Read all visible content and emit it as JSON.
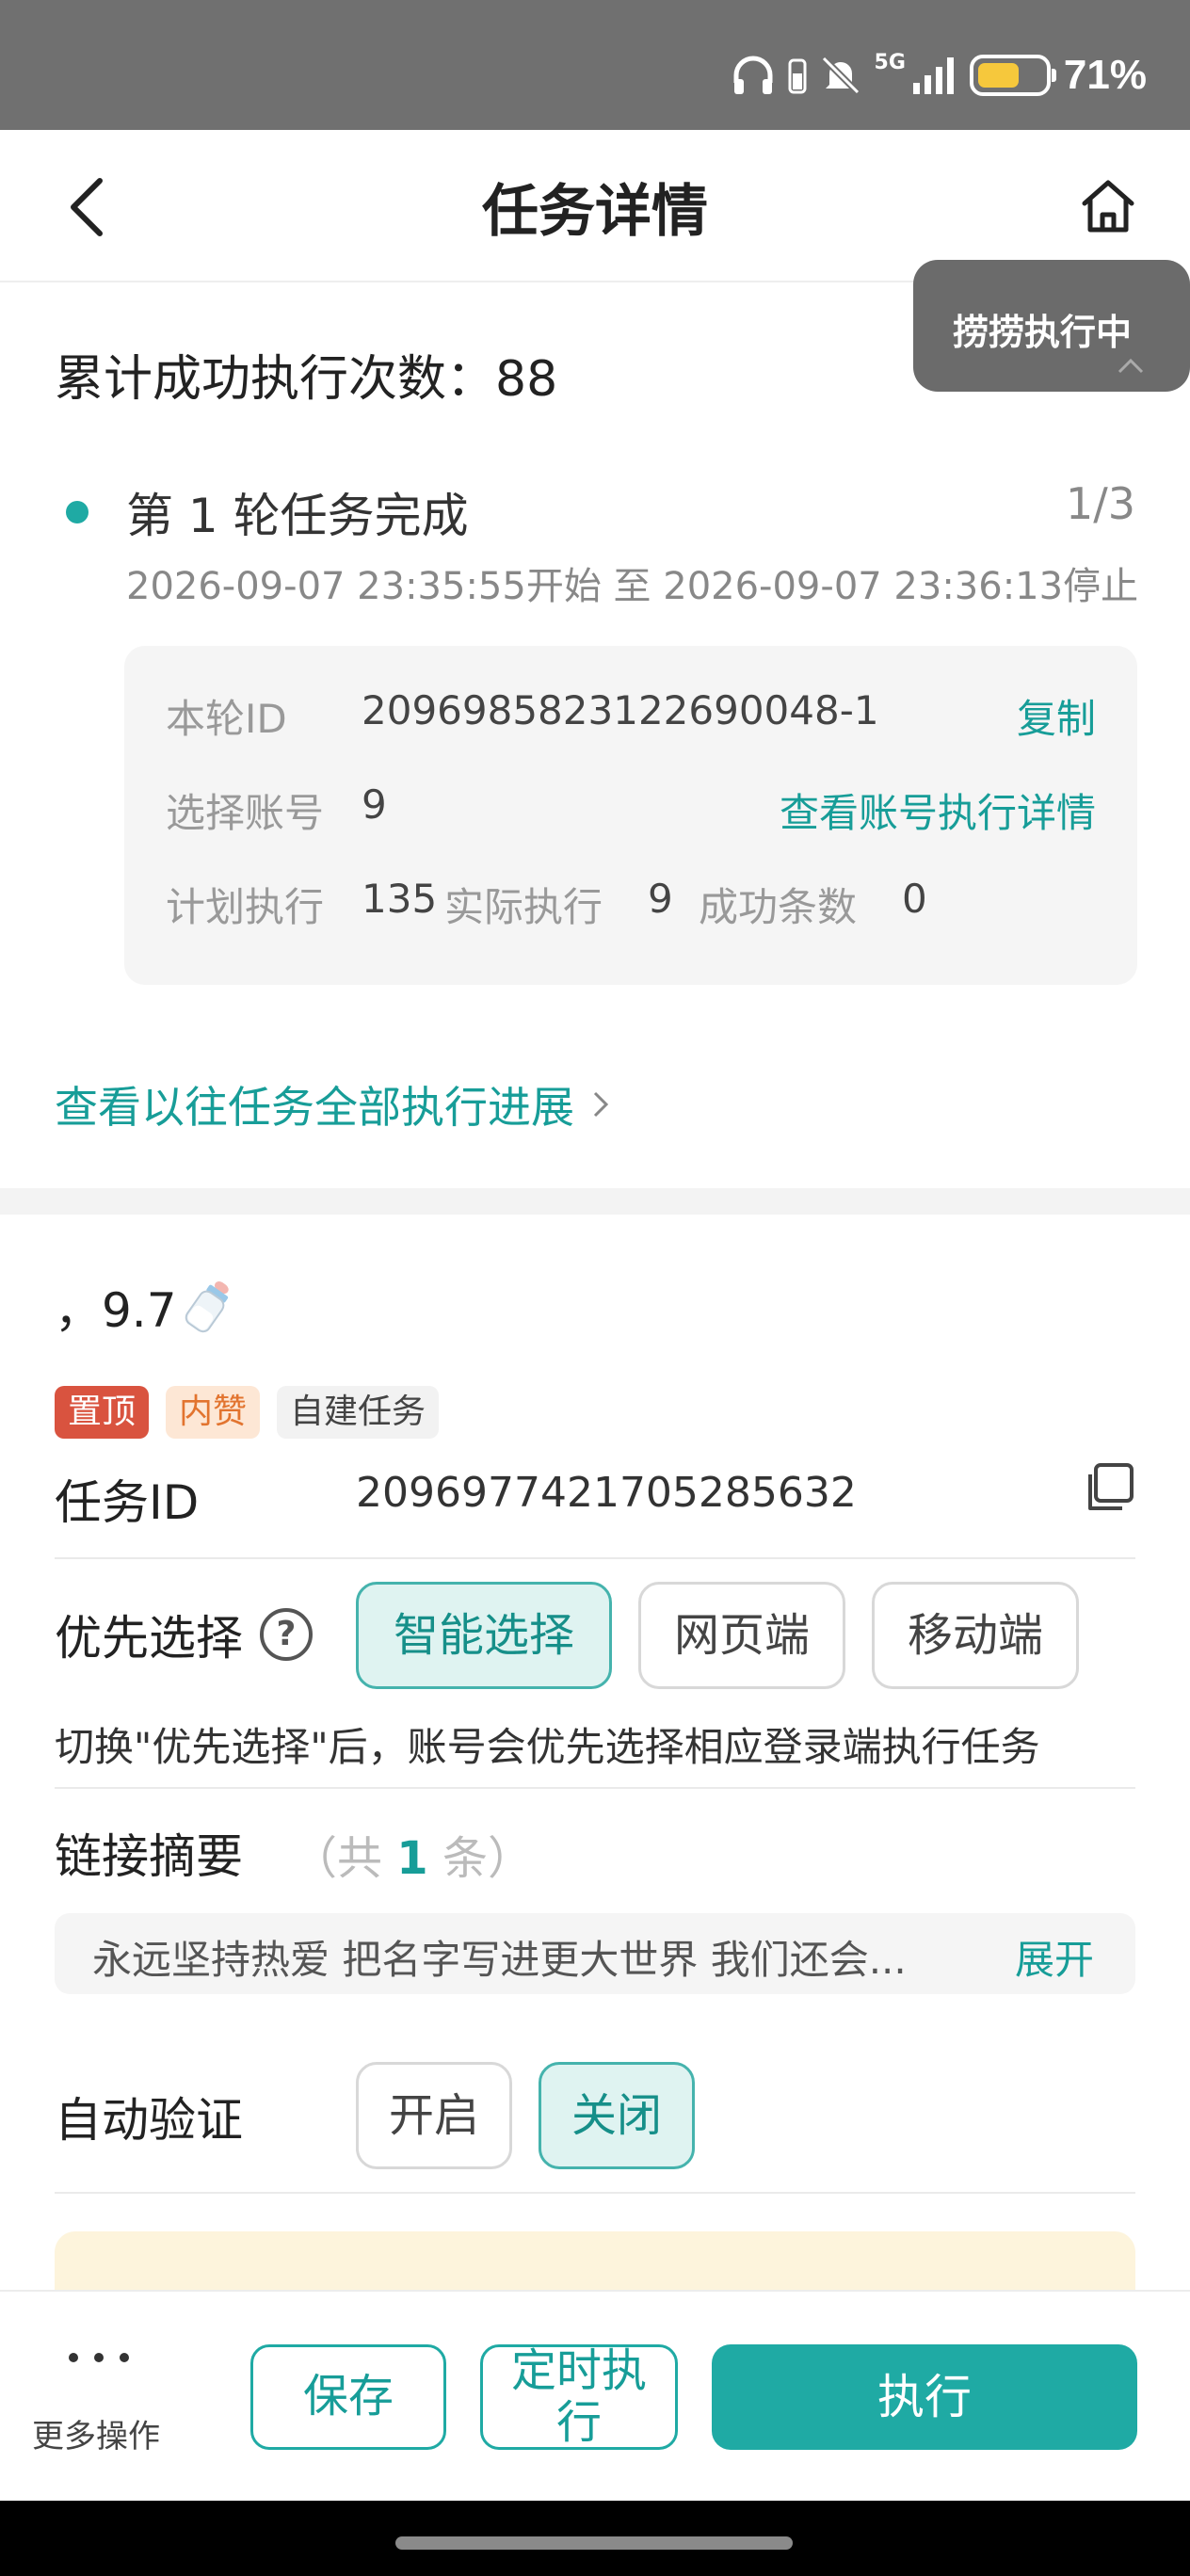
{
  "status_bar": {
    "network": "5G",
    "battery_percent": "71%",
    "battery_level": 0.71,
    "icons": [
      "headphones-icon",
      "mute-icon",
      "signal-icon",
      "battery-icon"
    ]
  },
  "header": {
    "title": "任务详情",
    "back_icon": "chevron-left-icon",
    "home_icon": "home-icon"
  },
  "floating_badge": {
    "label": "捞捞执行中"
  },
  "summary": {
    "label": "累计成功执行次数：88"
  },
  "round": {
    "title": "第 1 轮任务完成",
    "count": "1/3",
    "time": "2026-09-07 23:35:55开始 至 2026-09-07 23:36:13停止",
    "id_label": "本轮ID",
    "id_value": "2096985823122690048-1",
    "copy_label": "复制",
    "account_label": "选择账号",
    "account_value": "9",
    "account_link": "查看账号执行详情",
    "plan_label": "计划执行",
    "plan_value": "135",
    "actual_label": "实际执行",
    "actual_value": "9",
    "success_label": "成功条数",
    "success_value": "0"
  },
  "history_link": "查看以往任务全部执行进展",
  "task": {
    "name": "，9.7",
    "tags": [
      "置顶",
      "内赞",
      "自建任务"
    ],
    "id_label": "任务ID",
    "id_value": "2096977421705285632",
    "priority_label": "优先选择",
    "priority_help": "?",
    "priority_options": [
      "智能选择",
      "网页端",
      "移动端"
    ],
    "priority_selected": "智能选择",
    "priority_hint": "切换\"优先选择\"后，账号会优先选择相应登录端执行任务",
    "link_summary_label": "链接摘要",
    "link_count_prefix": "（共",
    "link_count_num": "1",
    "link_count_suffix": "条）",
    "link_summary_text": "永远坚持热爱 把名字写进更大世界 我们还会...",
    "expand_label": "展开",
    "auto_verify_label": "自动验证",
    "auto_verify_options": [
      "开启",
      "关闭"
    ],
    "auto_verify_selected": "关闭"
  },
  "bottom_bar": {
    "more_label": "更多操作",
    "save_label": "保存",
    "schedule_label_line1": "定时执",
    "schedule_label_line2": "行",
    "execute_label": "执行"
  },
  "colors": {
    "accent": "#1faaa4",
    "accent_text": "#179d98",
    "tag_top": "#d9533f",
    "tag_like_bg": "#fde7d5",
    "status_bar": "#707070"
  }
}
